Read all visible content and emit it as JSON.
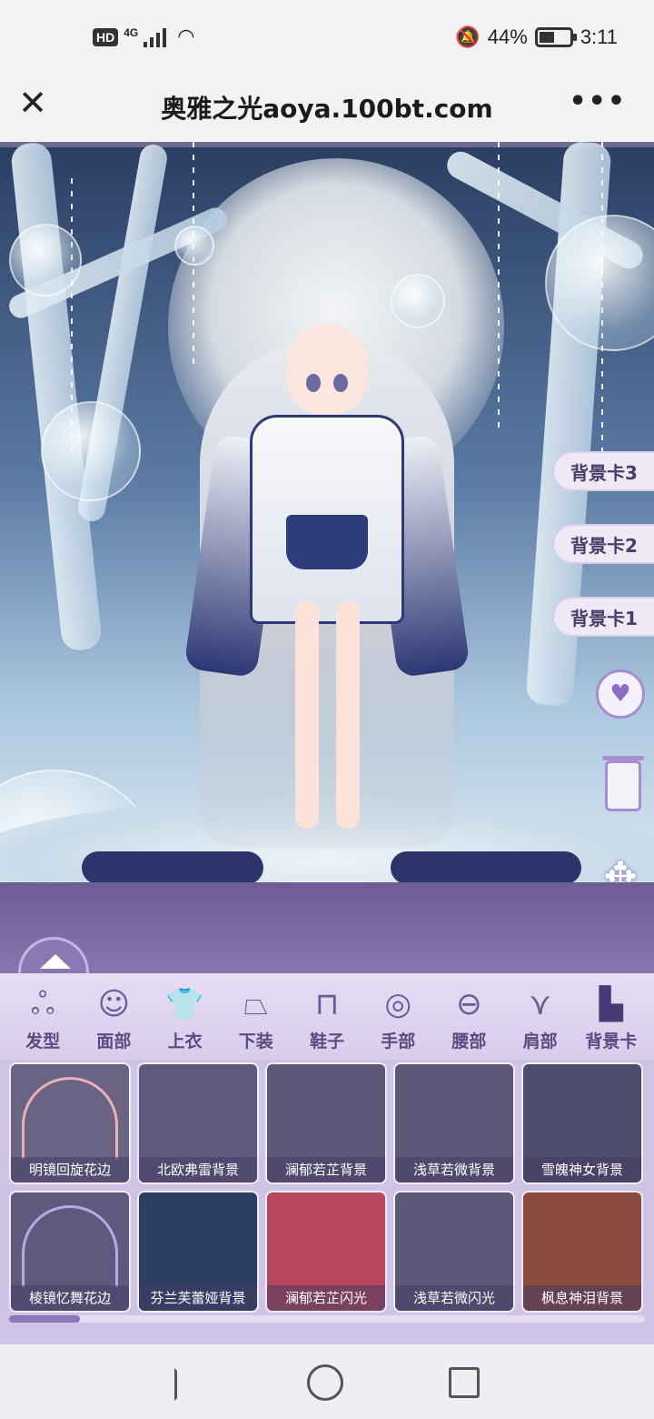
{
  "status_bar": {
    "network": "4G",
    "hd": "HD",
    "battery": "44%",
    "time": "3:11"
  },
  "title_bar": {
    "close_icon": "close-icon",
    "title": "奥雅之光aoya.100bt.com",
    "more_icon": "more-icon"
  },
  "scene": {
    "background_cards": [
      "背景卡3",
      "背景卡2",
      "背景卡1"
    ],
    "icons": [
      "rotate-heart-icon",
      "trash-icon",
      "move-icon"
    ]
  },
  "categories": [
    {
      "label": "发型",
      "icon": "hair-icon",
      "glyph": "ஃ"
    },
    {
      "label": "面部",
      "icon": "face-icon",
      "glyph": "☺"
    },
    {
      "label": "上衣",
      "icon": "top-icon",
      "glyph": "👕"
    },
    {
      "label": "下装",
      "icon": "skirt-icon",
      "glyph": "⏢"
    },
    {
      "label": "鞋子",
      "icon": "shoes-icon",
      "glyph": "⊓"
    },
    {
      "label": "手部",
      "icon": "ring-icon",
      "glyph": "◎"
    },
    {
      "label": "腰部",
      "icon": "belt-icon",
      "glyph": "⊖"
    },
    {
      "label": "肩部",
      "icon": "wings-icon",
      "glyph": "⋎"
    },
    {
      "label": "背景卡",
      "icon": "background-card-icon",
      "glyph": "▙",
      "active": true
    }
  ],
  "items": [
    {
      "label": "明镜回旋花边",
      "bg": "#6a6384",
      "arch": "#e7b2b8"
    },
    {
      "label": "北欧弗雷背景",
      "bg": "#5f5a7d",
      "arch": ""
    },
    {
      "label": "澜郁若芷背景",
      "bg": "#5e5878",
      "arch": ""
    },
    {
      "label": "浅草若微背景",
      "bg": "#5e5878",
      "arch": ""
    },
    {
      "label": "雪魄神女背景",
      "bg": "#4b4d6a",
      "arch": ""
    },
    {
      "label": "棱镜忆舞花边",
      "bg": "#5f5a7d",
      "arch": "#b6a9e6"
    },
    {
      "label": "芬兰芙蕾娅背景",
      "bg": "#2c3e63",
      "arch": ""
    },
    {
      "label": "澜郁若芷闪光",
      "bg": "#b8465c",
      "arch": ""
    },
    {
      "label": "浅草若微闪光",
      "bg": "#5e5878",
      "arch": ""
    },
    {
      "label": "枫息神泪背景",
      "bg": "#8a4a3d",
      "arch": ""
    }
  ],
  "colors": {
    "accent": "#8b76b8",
    "drawer": "#7a68a4",
    "tab_bg": "#e3d9f1"
  }
}
